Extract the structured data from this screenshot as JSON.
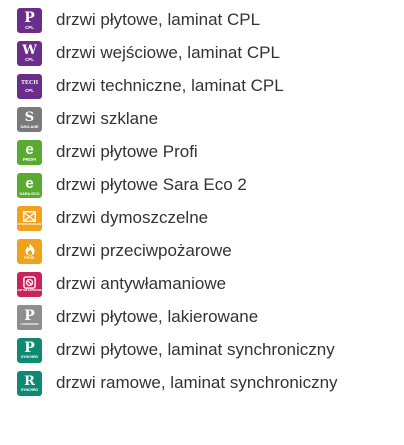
{
  "items": [
    {
      "label": "drzwi płytowe, laminat CPL",
      "icon": "p-cpl-icon",
      "badge_text": "P",
      "badge_sub": "CPL",
      "color": "#6b2d8a"
    },
    {
      "label": "drzwi wejściowe, laminat CPL",
      "icon": "w-cpl-icon",
      "badge_text": "W",
      "badge_sub": "CPL",
      "color": "#6b2d8a"
    },
    {
      "label": "drzwi techniczne, laminat CPL",
      "icon": "tech-cpl-icon",
      "badge_text": "TECH",
      "badge_sub": "CPL",
      "color": "#6b2d8a"
    },
    {
      "label": "drzwi szklane",
      "icon": "s-szklane-icon",
      "badge_text": "S",
      "badge_sub": "SZKLANE",
      "color": "#7a7a7a"
    },
    {
      "label": "drzwi płytowe Profi",
      "icon": "e-profi-icon",
      "badge_text": "e",
      "badge_sub": "PROFI",
      "color": "#5aaa32"
    },
    {
      "label": "drzwi płytowe Sara Eco 2",
      "icon": "e-sara-eco-icon",
      "badge_text": "e",
      "badge_sub": "SARA ECO",
      "color": "#5aaa32"
    },
    {
      "label": "drzwi dymoszczelne",
      "icon": "smoke-icon",
      "badge_text": "",
      "badge_sub": "DYMOSZCZELNE",
      "color": "#f0a21d"
    },
    {
      "label": "drzwi przeciwpożarowe",
      "icon": "fire-icon",
      "badge_text": "",
      "badge_sub": "P.POŻ.",
      "color": "#f0a21d"
    },
    {
      "label": "drzwi antywłamaniowe",
      "icon": "antiburglary-icon",
      "badge_text": "",
      "badge_sub": "ANTYWŁAMANIOWE",
      "color": "#c8245c"
    },
    {
      "label": "drzwi płytowe, lakierowane",
      "icon": "p-lakierowane-icon",
      "badge_text": "P",
      "badge_sub": "LAKIEROWANE",
      "color": "#8e8e8e"
    },
    {
      "label": "drzwi płytowe, laminat synchroniczny",
      "icon": "p-synchro-icon",
      "badge_text": "P",
      "badge_sub": "SYNCHRO",
      "color": "#0e8a72"
    },
    {
      "label": "drzwi ramowe, laminat synchroniczny",
      "icon": "r-synchro-icon",
      "badge_text": "R",
      "badge_sub": "SYNCHRO",
      "color": "#0e8a72"
    }
  ]
}
